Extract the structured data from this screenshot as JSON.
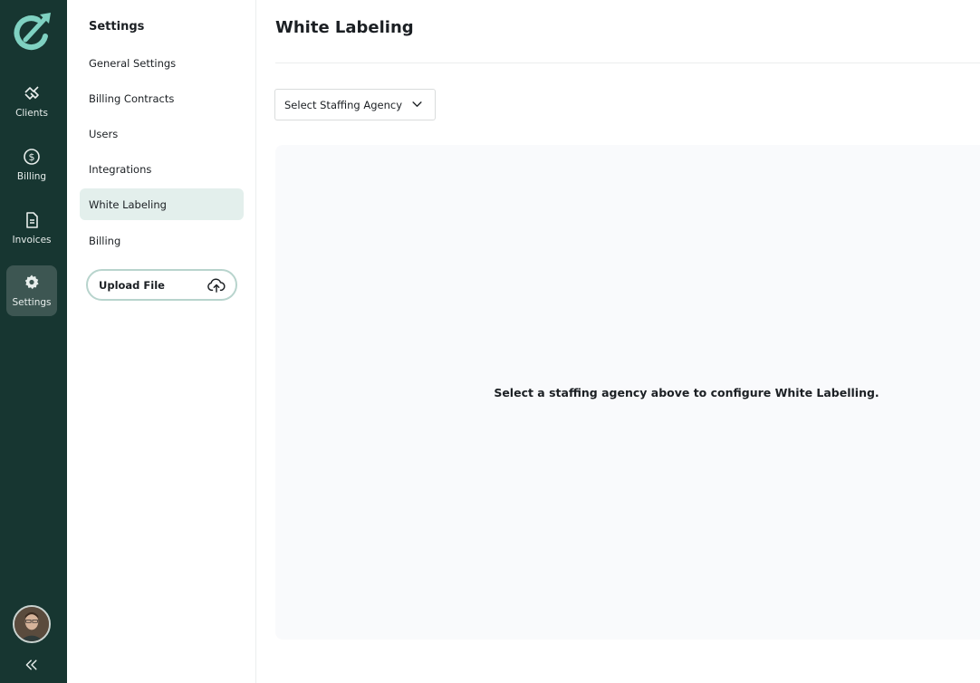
{
  "rail": {
    "items": [
      {
        "label": "Clients",
        "icon": "clients-icon"
      },
      {
        "label": "Billing",
        "icon": "dollar-icon"
      },
      {
        "label": "Invoices",
        "icon": "invoice-icon"
      },
      {
        "label": "Settings",
        "icon": "gear-icon"
      }
    ],
    "active": "Settings"
  },
  "panel": {
    "title": "Settings",
    "items": [
      {
        "label": "General Settings"
      },
      {
        "label": "Billing Contracts"
      },
      {
        "label": "Users"
      },
      {
        "label": "Integrations"
      },
      {
        "label": "White Labeling"
      },
      {
        "label": "Billing"
      }
    ],
    "active": "White Labeling",
    "upload_label": "Upload File"
  },
  "main": {
    "title": "White Labeling",
    "select_label": "Select Staffing Agency",
    "empty_message": "Select a staffing agency above to configure White Labelling."
  },
  "colors": {
    "rail_bg": "#173631",
    "accent": "#3dae96",
    "active_nav_bg": "#e3efec"
  }
}
